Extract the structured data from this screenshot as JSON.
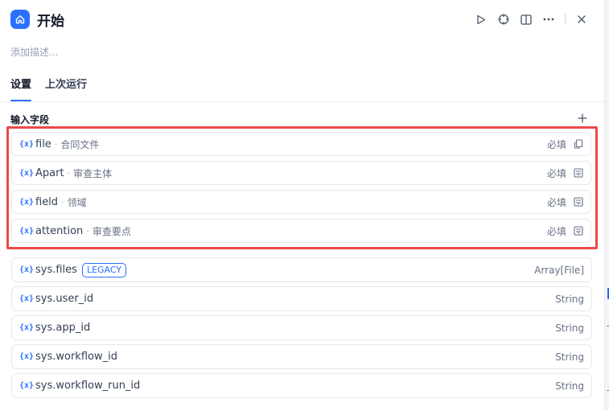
{
  "header": {
    "title": "开始",
    "icon": "home-icon",
    "actions": [
      "play-icon",
      "crosshair-icon",
      "book-icon",
      "more-icon",
      "close-icon"
    ]
  },
  "description_placeholder": "添加描述...",
  "tabs": [
    {
      "label": "设置",
      "active": true
    },
    {
      "label": "上次运行",
      "active": false
    }
  ],
  "inputs": {
    "section_label": "输入字段",
    "add_icon": "plus-icon",
    "required_fields": [
      {
        "name": "file",
        "label": "合同文件",
        "required": "必填",
        "icon": "copy-icon"
      },
      {
        "name": "Apart",
        "label": "审查主体",
        "required": "必填",
        "icon": "text-box-icon"
      },
      {
        "name": "field",
        "label": "领域",
        "required": "必填",
        "icon": "text-box-icon"
      },
      {
        "name": "attention",
        "label": "审查要点",
        "required": "必填",
        "icon": "text-box-icon"
      }
    ],
    "system_vars": [
      {
        "name": "sys.files",
        "badge": "LEGACY",
        "type": "Array[File]"
      },
      {
        "name": "sys.user_id",
        "type": "String"
      },
      {
        "name": "sys.app_id",
        "type": "String"
      },
      {
        "name": "sys.workflow_id",
        "type": "String"
      },
      {
        "name": "sys.workflow_run_id",
        "type": "String"
      }
    ],
    "var_glyph": "{x}"
  },
  "colors": {
    "accent": "#2970ff",
    "highlight_border": "#ea4a4a"
  }
}
